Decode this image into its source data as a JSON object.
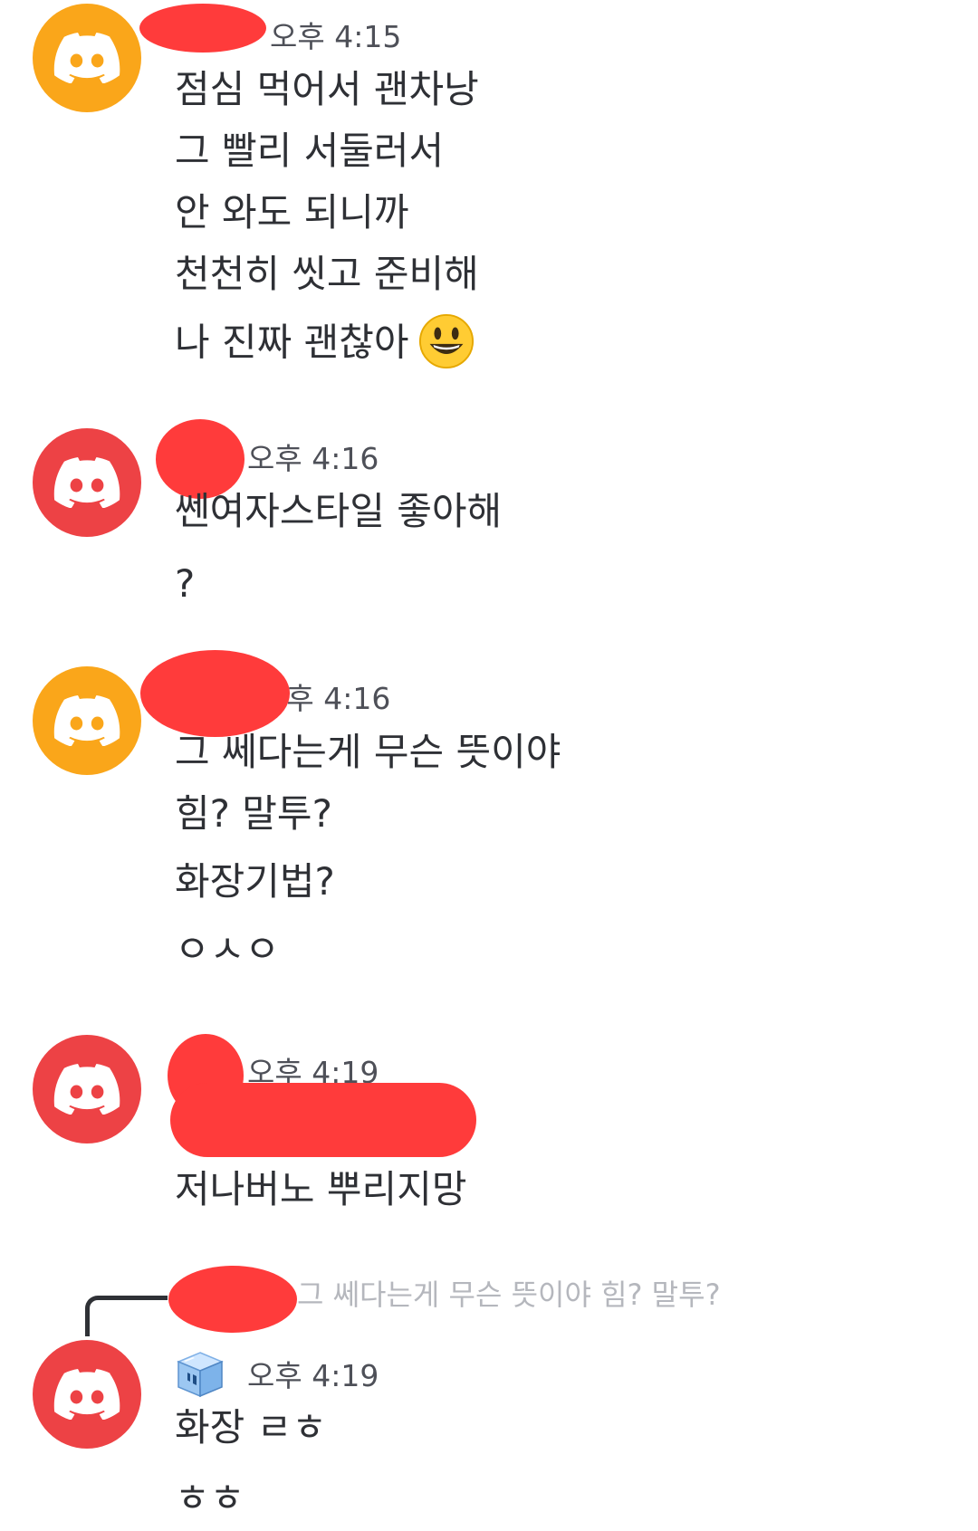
{
  "colors": {
    "avatar_orange": "#faa61a",
    "avatar_red": "#ed4245",
    "redaction": "#ff3b3b",
    "text": "#2e3035",
    "timestamp": "#4e5058",
    "reply_preview": "#b5b7bd"
  },
  "messages": [
    {
      "avatar": "discord-logo-icon",
      "avatar_color": "#faa61a",
      "time": "오후 4:15",
      "lines": [
        "점심 먹어서 괜차낭",
        "그 빨리 서둘러서",
        "안 와도 되니까",
        "천천히 씻고 준비해",
        "나 진짜 괜찮아"
      ],
      "emoji": "grinning-face-emoji"
    },
    {
      "avatar": "discord-logo-icon",
      "avatar_color": "#ed4245",
      "time": "오후 4:16",
      "lines": [
        "쎈여자스타일 좋아해",
        "?"
      ]
    },
    {
      "avatar": "discord-logo-icon",
      "avatar_color": "#faa61a",
      "time": "오후 4:16",
      "lines": [
        "그 쎄다는게 무슨 뜻이야",
        "힘? 말투?",
        "화장기법?",
        "ㅇㅅㅇ"
      ]
    },
    {
      "avatar": "discord-logo-icon",
      "avatar_color": "#ed4245",
      "time": "오후 4:19",
      "lines": [
        "저나버노 뿌리지망"
      ]
    },
    {
      "avatar": "discord-logo-icon",
      "avatar_color": "#ed4245",
      "reply_preview": "그 쎄다는게 무슨 뜻이야 힘? 말투?",
      "badge": "ice-cube-icon",
      "time": "오후 4:19",
      "lines": [
        "화장 ㄹㅎ",
        "ㅎㅎ"
      ]
    }
  ]
}
